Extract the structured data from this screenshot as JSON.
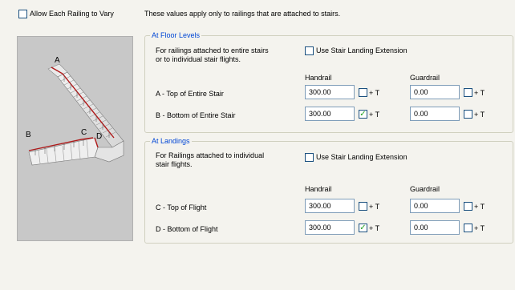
{
  "header": {
    "allow_vary_label": "Allow Each Railing to Vary",
    "allow_vary_checked": false,
    "description": "These values apply only to railings that are attached to stairs."
  },
  "preview": {
    "labels": {
      "a": "A",
      "b": "B",
      "c": "C",
      "d": "D"
    },
    "rail_color": "#b01818"
  },
  "columns": {
    "handrail": "Handrail",
    "guardrail": "Guardrail",
    "plus_t": "+ T"
  },
  "floor_levels": {
    "title": "At Floor Levels",
    "description_line1": "For railings attached to entire stairs",
    "description_line2": "or to individual stair flights.",
    "extension_label": "Use Stair Landing Extension",
    "extension_checked": false,
    "rows": [
      {
        "label": "A - Top of Entire Stair",
        "handrail": "300.00",
        "handrail_t": false,
        "guardrail": "0.00",
        "guardrail_t": false
      },
      {
        "label": "B - Bottom of Entire Stair",
        "handrail": "300.00",
        "handrail_t": true,
        "guardrail": "0.00",
        "guardrail_t": false
      }
    ]
  },
  "landings": {
    "title": "At Landings",
    "description_line1": "For Railings attached to individual",
    "description_line2": "stair flights.",
    "extension_label": "Use Stair Landing Extension",
    "extension_checked": false,
    "rows": [
      {
        "label": "C - Top of Flight",
        "handrail": "300.00",
        "handrail_t": false,
        "guardrail": "0.00",
        "guardrail_t": false
      },
      {
        "label": "D - Bottom of Flight",
        "handrail": "300.00",
        "handrail_t": true,
        "guardrail": "0.00",
        "guardrail_t": false
      }
    ]
  }
}
